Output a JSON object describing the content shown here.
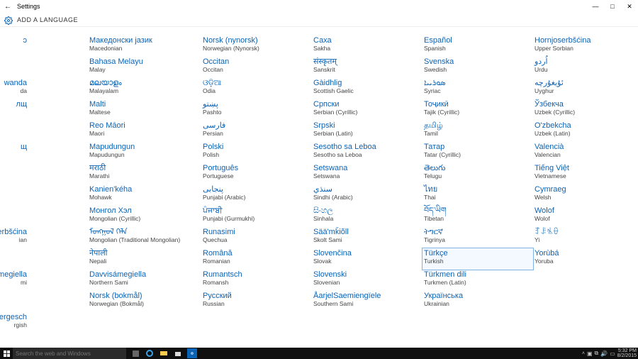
{
  "window": {
    "title": "Settings",
    "crumb": "ADD A LANGUAGE"
  },
  "columns": {
    "partial": [
      {
        "native": "ɔ",
        "eng": ""
      },
      {
        "native": "",
        "eng": ""
      },
      {
        "native": "wanda",
        "eng": "da"
      },
      {
        "native": "лщ",
        "eng": ""
      },
      {
        "native": "",
        "eng": ""
      },
      {
        "native": "щ",
        "eng": ""
      },
      {
        "native": "",
        "eng": ""
      },
      {
        "native": "",
        "eng": ""
      },
      {
        "native": "",
        "eng": ""
      },
      {
        "native": "erbšćina",
        "eng": "ian"
      },
      {
        "native": "",
        "eng": ""
      },
      {
        "native": "Sámegiella",
        "eng": "mi"
      },
      {
        "native": "",
        "eng": ""
      },
      {
        "native": "uergesch",
        "eng": "rgish"
      }
    ],
    "c1": [
      {
        "native": "Македонски јазик",
        "eng": "Macedonian"
      },
      {
        "native": "Bahasa Melayu",
        "eng": "Malay"
      },
      {
        "native": "മലയാളം",
        "eng": "Malayalam"
      },
      {
        "native": "Malti",
        "eng": "Maltese"
      },
      {
        "native": "Reo Māori",
        "eng": "Maori"
      },
      {
        "native": "Mapudungun",
        "eng": "Mapudungun"
      },
      {
        "native": "मराठी",
        "eng": "Marathi"
      },
      {
        "native": "Kanien'kéha",
        "eng": "Mohawk"
      },
      {
        "native": "Монгол Хэл",
        "eng": "Mongolian (Cyrillic)"
      },
      {
        "native": "ᠮᠣᠩᠭᠣᠯ ᠬᠡᠯᠡ",
        "eng": "Mongolian (Traditional Mongolian)"
      },
      {
        "native": "नेपाली",
        "eng": "Nepali"
      },
      {
        "native": "Davvisámegiella",
        "eng": "Northern Sami"
      },
      {
        "native": "Norsk (bokmål)",
        "eng": "Norwegian (Bokmål)"
      }
    ],
    "c2": [
      {
        "native": "Norsk (nynorsk)",
        "eng": "Norwegian (Nynorsk)"
      },
      {
        "native": "Occitan",
        "eng": "Occitan"
      },
      {
        "native": "ଓଡ଼ିଆ",
        "eng": "Odia"
      },
      {
        "native": "پښتو",
        "eng": "Pashto"
      },
      {
        "native": "فارسى",
        "eng": "Persian"
      },
      {
        "native": "Polski",
        "eng": "Polish"
      },
      {
        "native": "Português",
        "eng": "Portuguese"
      },
      {
        "native": "پنجابی",
        "eng": "Punjabi (Arabic)"
      },
      {
        "native": "ਪੰਜਾਬੀ",
        "eng": "Punjabi (Gurmukhi)"
      },
      {
        "native": "Runasimi",
        "eng": "Quechua"
      },
      {
        "native": "Română",
        "eng": "Romanian"
      },
      {
        "native": "Rumantsch",
        "eng": "Romansh"
      },
      {
        "native": "Русский",
        "eng": "Russian"
      }
    ],
    "c3": [
      {
        "native": "Саха",
        "eng": "Sakha"
      },
      {
        "native": "संस्कृतम्",
        "eng": "Sanskrit"
      },
      {
        "native": "Gàidhlig",
        "eng": "Scottish Gaelic"
      },
      {
        "native": "Српски",
        "eng": "Serbian (Cyrillic)"
      },
      {
        "native": "Srpski",
        "eng": "Serbian (Latin)"
      },
      {
        "native": "Sesotho sa Leboa",
        "eng": "Sesotho sa Leboa"
      },
      {
        "native": "Setswana",
        "eng": "Setswana"
      },
      {
        "native": "سنڌي",
        "eng": "Sindhi (Arabic)"
      },
      {
        "native": "සිංහල",
        "eng": "Sinhala"
      },
      {
        "native": "Sää'mǩiõll",
        "eng": "Skolt Sami"
      },
      {
        "native": "Slovenčina",
        "eng": "Slovak"
      },
      {
        "native": "Slovenski",
        "eng": "Slovenian"
      },
      {
        "native": "ÅarjelSaemiengïele",
        "eng": "Southern Sami"
      }
    ],
    "c4": [
      {
        "native": "Español",
        "eng": "Spanish"
      },
      {
        "native": "Svenska",
        "eng": "Swedish"
      },
      {
        "native": "ܣܘܪܝܝܐ",
        "eng": "Syriac"
      },
      {
        "native": "Тоҷикӣ",
        "eng": "Tajik (Cyrillic)"
      },
      {
        "native": "தமிழ்",
        "eng": "Tamil"
      },
      {
        "native": "Татар",
        "eng": "Tatar (Cyrillic)"
      },
      {
        "native": "తెలుగు",
        "eng": "Telugu"
      },
      {
        "native": "ไทย",
        "eng": "Thai"
      },
      {
        "native": "བོད་ཡིག",
        "eng": "Tibetan"
      },
      {
        "native": "ትግርኛ",
        "eng": "Tigrinya"
      },
      {
        "native": "Türkçe",
        "eng": "Turkish",
        "hover": true
      },
      {
        "native": "Türkmen dili",
        "eng": "Turkmen (Latin)"
      },
      {
        "native": "Українська",
        "eng": "Ukrainian"
      }
    ],
    "c5": [
      {
        "native": "Hornjoserbšćina",
        "eng": "Upper Sorbian"
      },
      {
        "native": "اُردو",
        "eng": "Urdu"
      },
      {
        "native": "ئۇيغۇرچە",
        "eng": "Uyghur"
      },
      {
        "native": "Ўзбекча",
        "eng": "Uzbek (Cyrillic)"
      },
      {
        "native": "O'zbekcha",
        "eng": "Uzbek (Latin)"
      },
      {
        "native": "Valencià",
        "eng": "Valencian"
      },
      {
        "native": "Tiếng Việt",
        "eng": "Vietnamese"
      },
      {
        "native": "Cymraeg",
        "eng": "Welsh"
      },
      {
        "native": "Wolof",
        "eng": "Wolof"
      },
      {
        "native": "ꆈꌠꁱꂷ",
        "eng": "Yi"
      },
      {
        "native": "Yorùbá",
        "eng": "Yoruba"
      }
    ]
  },
  "taskbar": {
    "search_placeholder": "Search the web and Windows",
    "clock_time": "5:32 PM",
    "clock_date": "8/2/2015"
  }
}
